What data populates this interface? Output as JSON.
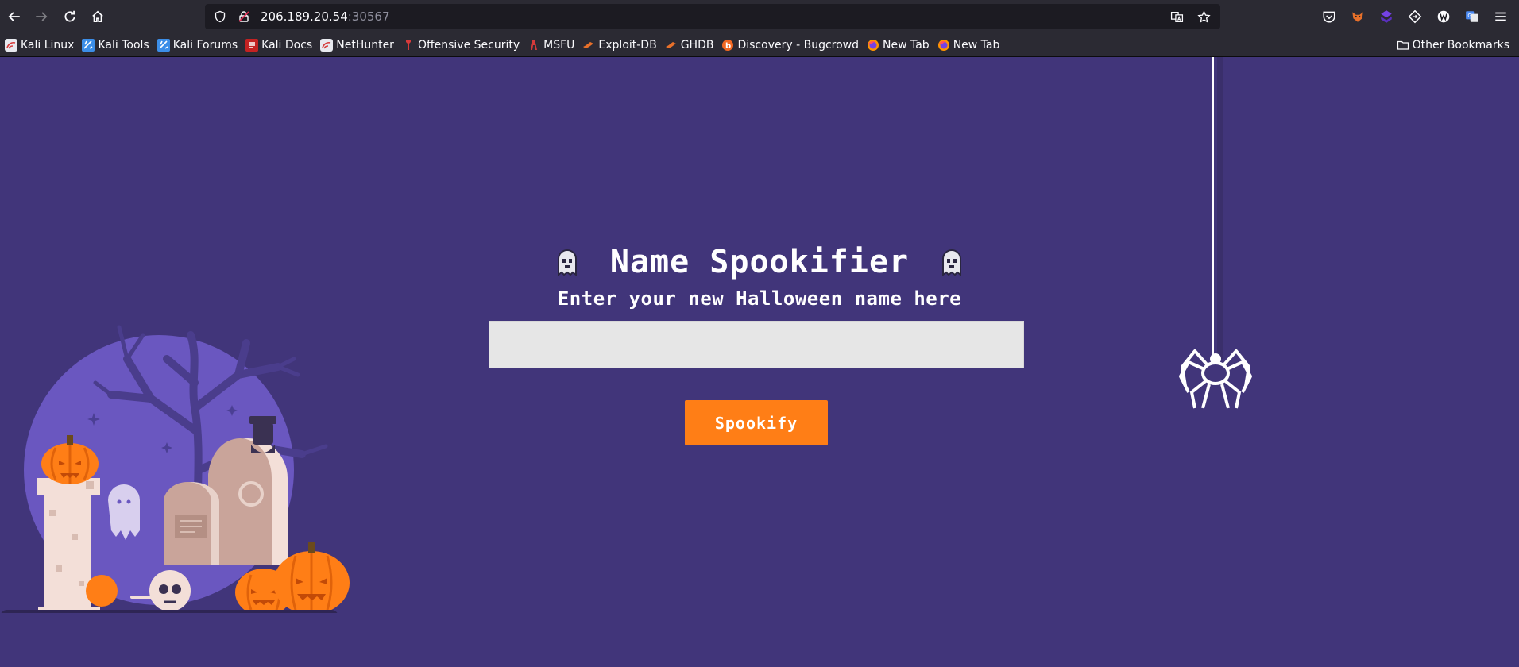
{
  "browser": {
    "url_host": "206.189.20.54",
    "url_port": ":30567"
  },
  "bookmarks": [
    {
      "label": "Kali Linux",
      "icon": "kali-icon"
    },
    {
      "label": "Kali Tools",
      "icon": "kali-tools-icon"
    },
    {
      "label": "Kali Forums",
      "icon": "kali-forums-icon"
    },
    {
      "label": "Kali Docs",
      "icon": "kali-docs-icon"
    },
    {
      "label": "NetHunter",
      "icon": "nethunter-icon"
    },
    {
      "label": "Offensive Security",
      "icon": "offsec-icon"
    },
    {
      "label": "MSFU",
      "icon": "msfu-icon"
    },
    {
      "label": "Exploit-DB",
      "icon": "exploitdb-icon"
    },
    {
      "label": "GHDB",
      "icon": "ghdb-icon"
    },
    {
      "label": "Discovery - Bugcrowd",
      "icon": "bugcrowd-icon"
    },
    {
      "label": "New Tab",
      "icon": "firefox-icon"
    },
    {
      "label": "New Tab",
      "icon": "firefox-icon"
    }
  ],
  "other_bookmarks": "Other Bookmarks",
  "page": {
    "title": "Name Spookifier",
    "subtitle": "Enter your new Halloween name here",
    "input_value": "",
    "button_label": "Spookify"
  },
  "colors": {
    "page_bg": "#41357a",
    "button_bg": "#ff7e16",
    "input_bg": "#e6e6e6",
    "moon": "#6a57c0"
  }
}
